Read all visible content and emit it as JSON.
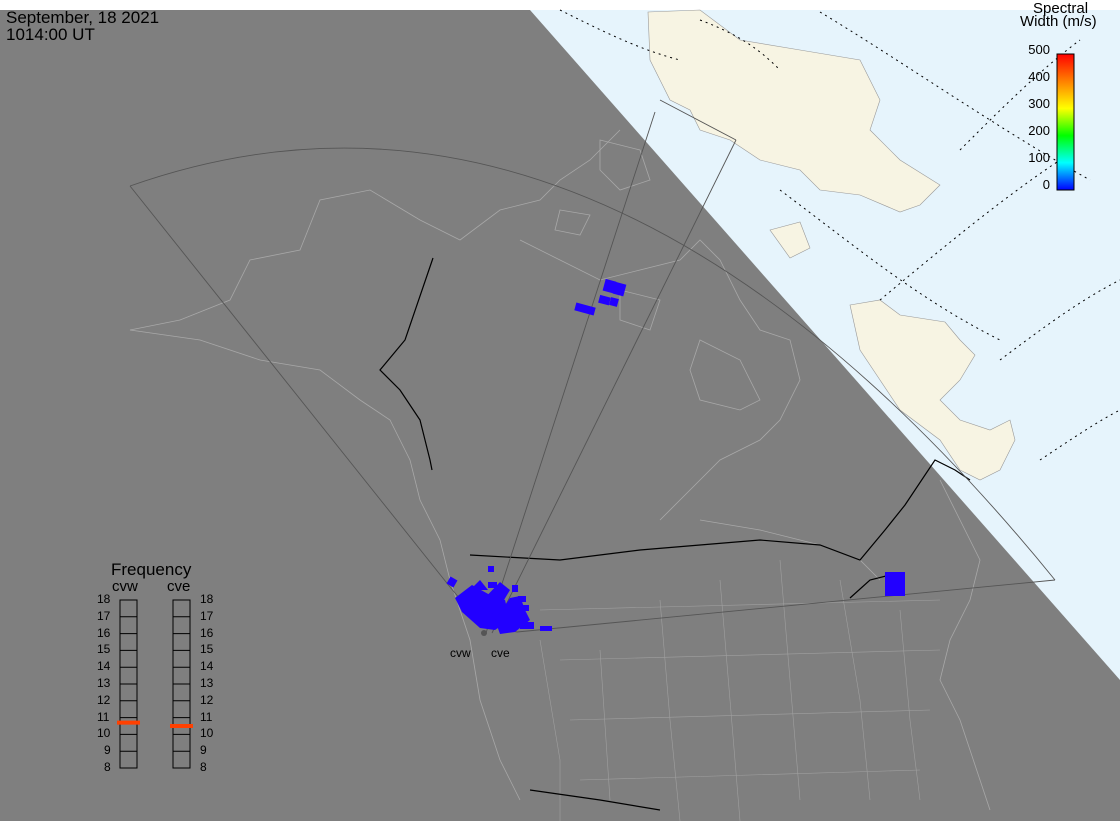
{
  "title": {
    "date": "September, 18 2021",
    "time": "1014:00 UT"
  },
  "colorbar": {
    "title_line1": "Spectral",
    "title_line2": "Width (m/s)",
    "ticks": [
      "500",
      "400",
      "300",
      "200",
      "100",
      "0"
    ],
    "colors": [
      "#ff0000",
      "#ff8000",
      "#ffff00",
      "#00ff00",
      "#00ffff",
      "#0000ff"
    ]
  },
  "frequency": {
    "title": "Frequency",
    "radars": [
      "cvw",
      "cve"
    ],
    "ticks": [
      "18",
      "17",
      "16",
      "15",
      "14",
      "13",
      "12",
      "11",
      "10",
      "9",
      "8"
    ],
    "cvw_mhz": 10.7,
    "cve_mhz": 10.5,
    "marker_color": "#ff4000"
  },
  "radar_labels": [
    "cvw",
    "cve"
  ],
  "colors": {
    "night": "#7f7f7f",
    "ocean_day": "#e6f4fc",
    "land_day": "#f7f4e3",
    "scatter": "#2200ff"
  }
}
